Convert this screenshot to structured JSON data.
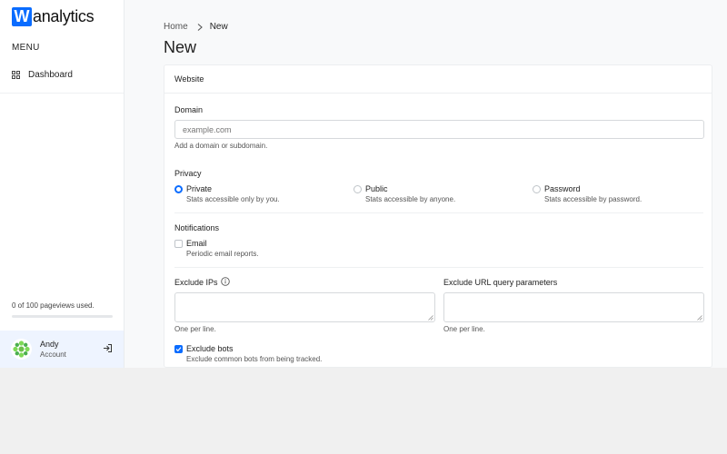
{
  "brand": {
    "logo_letter": "W",
    "name": "analytics",
    "accent": "#0a6cff"
  },
  "sidebar": {
    "menu_title": "MENU",
    "items": [
      {
        "label": "Dashboard",
        "icon": "grid-icon"
      }
    ],
    "usage": {
      "text": "0 of 100 pageviews used.",
      "used": 0,
      "total": 100
    },
    "account": {
      "name": "Andy",
      "subtitle": "Account"
    }
  },
  "breadcrumb": {
    "home": "Home",
    "current": "New"
  },
  "page": {
    "title": "New"
  },
  "card": {
    "title": "Website",
    "domain": {
      "label": "Domain",
      "placeholder": "example.com",
      "value": "",
      "help": "Add a domain or subdomain."
    },
    "privacy": {
      "label": "Privacy",
      "selected": "Private",
      "options": [
        {
          "label": "Private",
          "desc": "Stats accessible only by you."
        },
        {
          "label": "Public",
          "desc": "Stats accessible by anyone."
        },
        {
          "label": "Password",
          "desc": "Stats accessible by password."
        }
      ]
    },
    "notifications": {
      "label": "Notifications",
      "email": {
        "label": "Email",
        "desc": "Periodic email reports.",
        "checked": false
      }
    },
    "exclude_ips": {
      "label": "Exclude IPs",
      "help": "One per line.",
      "value": ""
    },
    "exclude_params": {
      "label": "Exclude URL query parameters",
      "help": "One per line.",
      "value": ""
    },
    "exclude_bots": {
      "label": "Exclude bots",
      "desc": "Exclude common bots from being tracked.",
      "checked": true
    }
  }
}
